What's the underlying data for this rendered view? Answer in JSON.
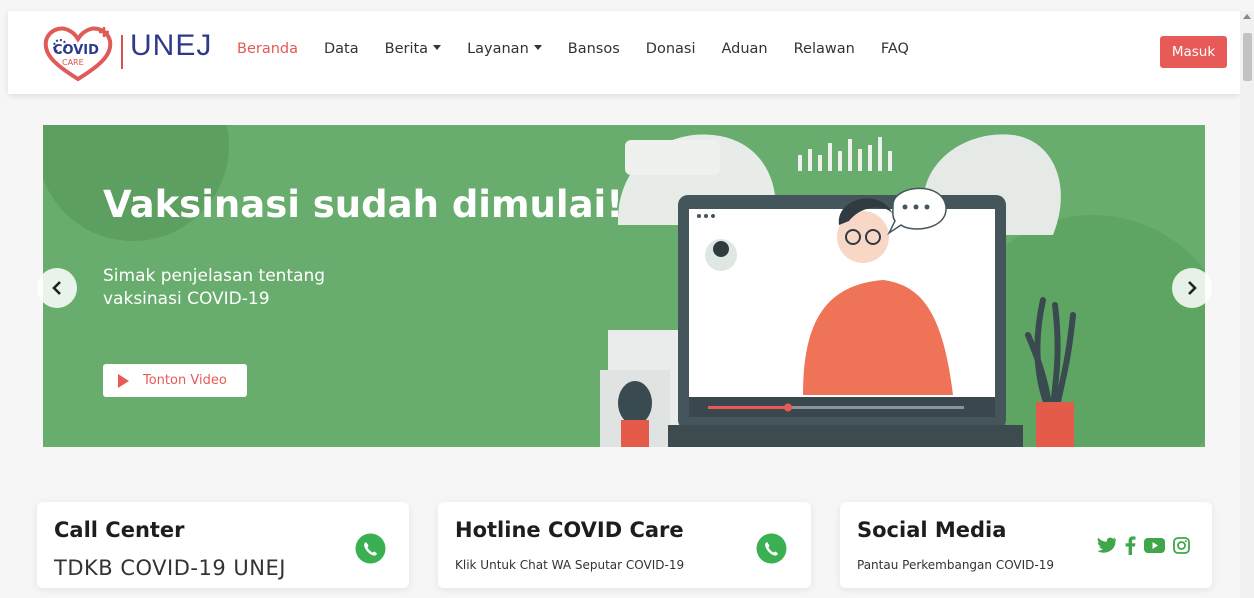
{
  "brand": {
    "logo_line1": "COVID",
    "logo_line2": "CARE",
    "name": "UNEJ"
  },
  "nav": {
    "items": [
      {
        "label": "Beranda",
        "active": true,
        "dropdown": false
      },
      {
        "label": "Data",
        "active": false,
        "dropdown": false
      },
      {
        "label": "Berita",
        "active": false,
        "dropdown": true
      },
      {
        "label": "Layanan",
        "active": false,
        "dropdown": true
      },
      {
        "label": "Bansos",
        "active": false,
        "dropdown": false
      },
      {
        "label": "Donasi",
        "active": false,
        "dropdown": false
      },
      {
        "label": "Aduan",
        "active": false,
        "dropdown": false
      },
      {
        "label": "Relawan",
        "active": false,
        "dropdown": false
      },
      {
        "label": "FAQ",
        "active": false,
        "dropdown": false
      }
    ],
    "login_label": "Masuk"
  },
  "hero": {
    "title": "Vaksinasi sudah dimulai!",
    "subtitle_line1": "Simak penjelasan tentang",
    "subtitle_line2": "vaksinasi COVID-19",
    "button_label": "Tonton Video",
    "prev_icon": "chevron-left-icon",
    "next_icon": "chevron-right-icon"
  },
  "cards": {
    "call_center": {
      "title": "Call Center",
      "text": "TDKB COVID-19 UNEJ",
      "icon": "whatsapp-icon"
    },
    "hotline": {
      "title": "Hotline COVID Care",
      "text": "Klik Untuk Chat WA Seputar COVID-19",
      "icon": "whatsapp-icon"
    },
    "social": {
      "title": "Social Media",
      "text": "Pantau Perkembangan COVID-19",
      "icons": [
        "twitter-icon",
        "facebook-icon",
        "youtube-icon",
        "instagram-icon"
      ]
    }
  },
  "colors": {
    "accent": "#e75a57",
    "brand_blue": "#2d3a8c",
    "hero_green": "#68ad6d",
    "whatsapp": "#3bb052",
    "social": "#3fa64a"
  }
}
